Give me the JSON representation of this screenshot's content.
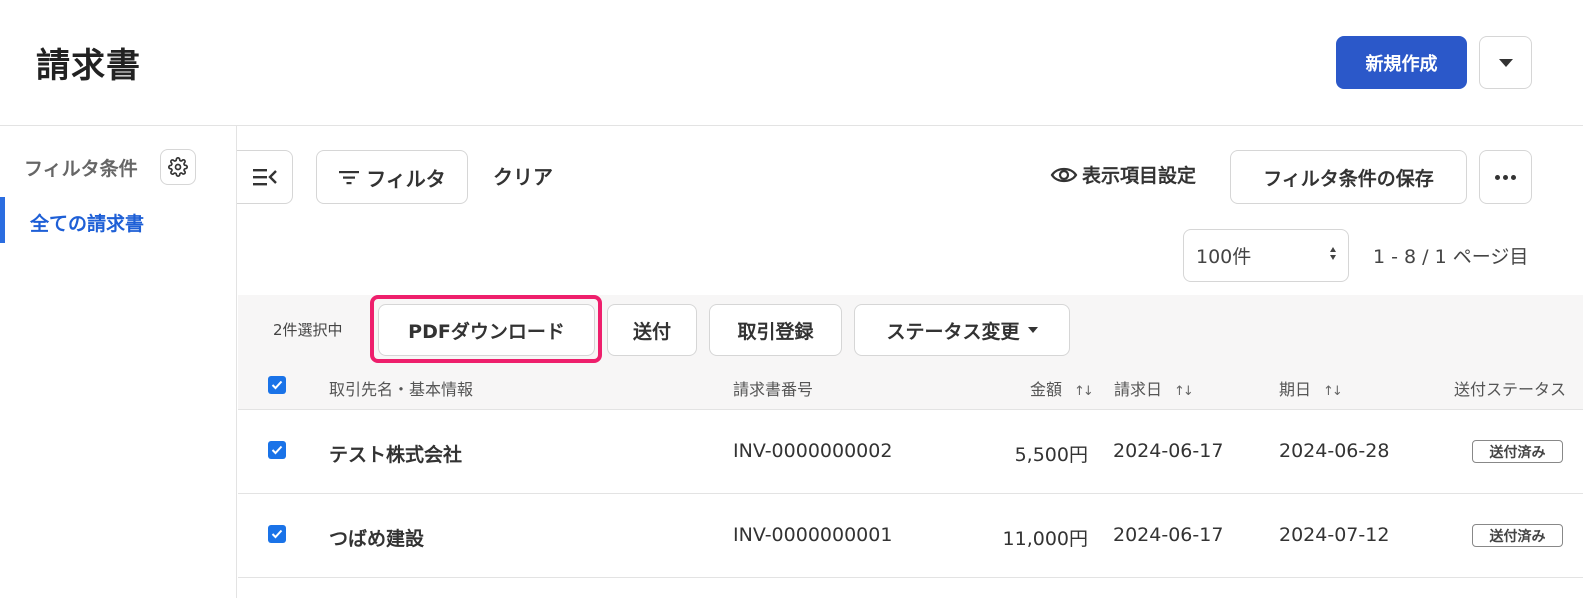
{
  "header": {
    "title": "請求書",
    "create_label": "新規作成"
  },
  "sidebar": {
    "filter_heading": "フィルタ条件",
    "items": [
      {
        "label": "全ての請求書",
        "active": true
      }
    ]
  },
  "toolbar": {
    "filter_label": "フィルタ",
    "clear_label": "クリア",
    "column_settings_label": "表示項目設定",
    "save_filter_label": "フィルタ条件の保存"
  },
  "pagination": {
    "per_page": "100件",
    "info": "1 - 8 / 1 ページ目"
  },
  "bulk": {
    "selected_text": "2件選択中",
    "actions": [
      "PDFダウンロード",
      "送付",
      "取引登録",
      "ステータス変更"
    ]
  },
  "table": {
    "columns": [
      "取引先名・基本情報",
      "請求書番号",
      "金額",
      "請求日",
      "期日",
      "送付ステータス"
    ],
    "rows": [
      {
        "name": "テスト株式会社",
        "number": "INV-0000000002",
        "amount": "5,500円",
        "issue_date": "2024-06-17",
        "due_date": "2024-06-28",
        "status": "送付済み",
        "checked": true
      },
      {
        "name": "つばめ建設",
        "number": "INV-0000000001",
        "amount": "11,000円",
        "issue_date": "2024-06-17",
        "due_date": "2024-07-12",
        "status": "送付済み",
        "checked": true
      }
    ]
  },
  "colors": {
    "primary": "#2b58c9",
    "highlight": "#ee1f6c",
    "active": "#1e5fd6",
    "checkbox": "#1a73e8"
  }
}
